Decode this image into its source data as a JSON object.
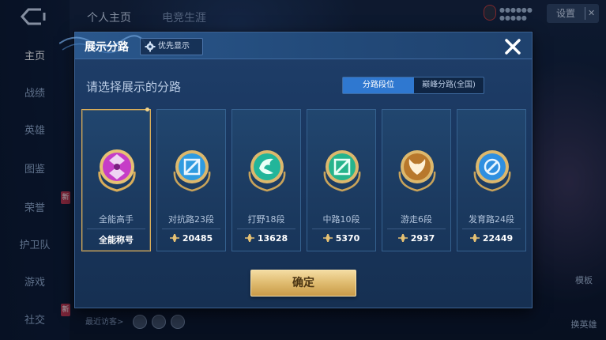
{
  "background": {
    "top_tabs": [
      "个人主页",
      "电竞生涯"
    ],
    "nav_items": [
      {
        "label": "主页",
        "active": true
      },
      {
        "label": "战绩"
      },
      {
        "label": "英雄"
      },
      {
        "label": "图鉴"
      },
      {
        "label": "荣誉",
        "badge": "新"
      },
      {
        "label": "护卫队"
      },
      {
        "label": "游戏"
      },
      {
        "label": "社交",
        "badge": "新"
      }
    ],
    "user_line1": "●●●●●●",
    "user_line2": "●●●●●",
    "settings_label": "设置",
    "visitors_label": "最近访客>",
    "bottom_right_1": "模板",
    "bottom_right_2": "换英雄"
  },
  "modal": {
    "title": "展示分路",
    "priority_label": "优先显示",
    "subtitle": "请选择展示的分路",
    "toggle": {
      "option1": "分路段位",
      "option2": "巅峰分路(全国)"
    },
    "cards": [
      {
        "name": "全能高手",
        "score": "全能称号",
        "selected": true,
        "emblem": "allround-emblem-icon",
        "color": "#c63dc7"
      },
      {
        "name": "对抗路23段",
        "score": "20485",
        "emblem": "clash-lane-emblem-icon",
        "color": "#2f9be0"
      },
      {
        "name": "打野18段",
        "score": "13628",
        "emblem": "jungle-emblem-icon",
        "color": "#22b59a"
      },
      {
        "name": "中路10段",
        "score": "5370",
        "emblem": "mid-lane-emblem-icon",
        "color": "#26b48c"
      },
      {
        "name": "游走6段",
        "score": "2937",
        "emblem": "roam-emblem-icon",
        "color": "#c9893a"
      },
      {
        "name": "发育路24段",
        "score": "22449",
        "emblem": "farm-lane-emblem-icon",
        "color": "#2f8fe0"
      }
    ],
    "confirm_label": "确定"
  },
  "colors": {
    "accent_blue": "#2f78d0",
    "gold": "#d8ad5a",
    "modal_bg": "#1c3b61"
  }
}
